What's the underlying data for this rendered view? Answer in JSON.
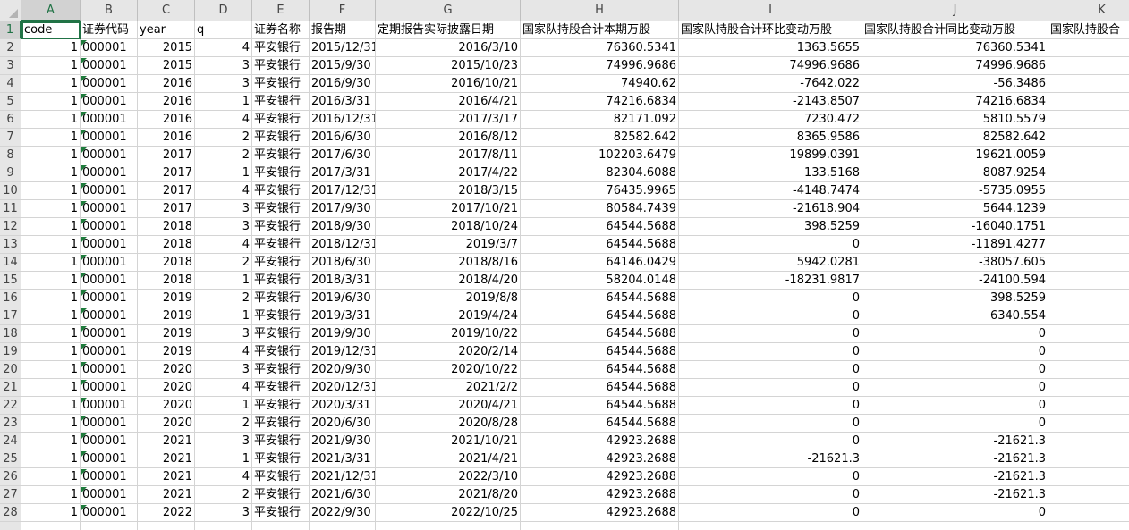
{
  "columns": [
    "A",
    "B",
    "C",
    "D",
    "E",
    "F",
    "G",
    "H",
    "I",
    "J",
    "K"
  ],
  "active_cell": "A1",
  "header_row": [
    "code",
    "证券代码",
    "year",
    "q",
    "证券名称",
    "报告期",
    "定期报告实际披露日期",
    "国家队持股合计本期万股",
    "国家队持股合计环比变动万股",
    "国家队持股合计同比变动万股",
    "国家队持股合"
  ],
  "rows": [
    {
      "n": "2",
      "code": "1",
      "sec": "000001",
      "year": "2015",
      "q": "4",
      "name": "平安银行",
      "period": "2015/12/31",
      "date": "2016/3/10",
      "h": "76360.5341",
      "i": "1363.5655",
      "j": "76360.5341"
    },
    {
      "n": "3",
      "code": "1",
      "sec": "000001",
      "year": "2015",
      "q": "3",
      "name": "平安银行",
      "period": "2015/9/30",
      "date": "2015/10/23",
      "h": "74996.9686",
      "i": "74996.9686",
      "j": "74996.9686"
    },
    {
      "n": "4",
      "code": "1",
      "sec": "000001",
      "year": "2016",
      "q": "3",
      "name": "平安银行",
      "period": "2016/9/30",
      "date": "2016/10/21",
      "h": "74940.62",
      "i": "-7642.022",
      "j": "-56.3486"
    },
    {
      "n": "5",
      "code": "1",
      "sec": "000001",
      "year": "2016",
      "q": "1",
      "name": "平安银行",
      "period": "2016/3/31",
      "date": "2016/4/21",
      "h": "74216.6834",
      "i": "-2143.8507",
      "j": "74216.6834"
    },
    {
      "n": "6",
      "code": "1",
      "sec": "000001",
      "year": "2016",
      "q": "4",
      "name": "平安银行",
      "period": "2016/12/31",
      "date": "2017/3/17",
      "h": "82171.092",
      "i": "7230.472",
      "j": "5810.5579"
    },
    {
      "n": "7",
      "code": "1",
      "sec": "000001",
      "year": "2016",
      "q": "2",
      "name": "平安银行",
      "period": "2016/6/30",
      "date": "2016/8/12",
      "h": "82582.642",
      "i": "8365.9586",
      "j": "82582.642"
    },
    {
      "n": "8",
      "code": "1",
      "sec": "000001",
      "year": "2017",
      "q": "2",
      "name": "平安银行",
      "period": "2017/6/30",
      "date": "2017/8/11",
      "h": "102203.6479",
      "i": "19899.0391",
      "j": "19621.0059"
    },
    {
      "n": "9",
      "code": "1",
      "sec": "000001",
      "year": "2017",
      "q": "1",
      "name": "平安银行",
      "period": "2017/3/31",
      "date": "2017/4/22",
      "h": "82304.6088",
      "i": "133.5168",
      "j": "8087.9254"
    },
    {
      "n": "10",
      "code": "1",
      "sec": "000001",
      "year": "2017",
      "q": "4",
      "name": "平安银行",
      "period": "2017/12/31",
      "date": "2018/3/15",
      "h": "76435.9965",
      "i": "-4148.7474",
      "j": "-5735.0955"
    },
    {
      "n": "11",
      "code": "1",
      "sec": "000001",
      "year": "2017",
      "q": "3",
      "name": "平安银行",
      "period": "2017/9/30",
      "date": "2017/10/21",
      "h": "80584.7439",
      "i": "-21618.904",
      "j": "5644.1239"
    },
    {
      "n": "12",
      "code": "1",
      "sec": "000001",
      "year": "2018",
      "q": "3",
      "name": "平安银行",
      "period": "2018/9/30",
      "date": "2018/10/24",
      "h": "64544.5688",
      "i": "398.5259",
      "j": "-16040.1751"
    },
    {
      "n": "13",
      "code": "1",
      "sec": "000001",
      "year": "2018",
      "q": "4",
      "name": "平安银行",
      "period": "2018/12/31",
      "date": "2019/3/7",
      "h": "64544.5688",
      "i": "0",
      "j": "-11891.4277"
    },
    {
      "n": "14",
      "code": "1",
      "sec": "000001",
      "year": "2018",
      "q": "2",
      "name": "平安银行",
      "period": "2018/6/30",
      "date": "2018/8/16",
      "h": "64146.0429",
      "i": "5942.0281",
      "j": "-38057.605"
    },
    {
      "n": "15",
      "code": "1",
      "sec": "000001",
      "year": "2018",
      "q": "1",
      "name": "平安银行",
      "period": "2018/3/31",
      "date": "2018/4/20",
      "h": "58204.0148",
      "i": "-18231.9817",
      "j": "-24100.594"
    },
    {
      "n": "16",
      "code": "1",
      "sec": "000001",
      "year": "2019",
      "q": "2",
      "name": "平安银行",
      "period": "2019/6/30",
      "date": "2019/8/8",
      "h": "64544.5688",
      "i": "0",
      "j": "398.5259"
    },
    {
      "n": "17",
      "code": "1",
      "sec": "000001",
      "year": "2019",
      "q": "1",
      "name": "平安银行",
      "period": "2019/3/31",
      "date": "2019/4/24",
      "h": "64544.5688",
      "i": "0",
      "j": "6340.554"
    },
    {
      "n": "18",
      "code": "1",
      "sec": "000001",
      "year": "2019",
      "q": "3",
      "name": "平安银行",
      "period": "2019/9/30",
      "date": "2019/10/22",
      "h": "64544.5688",
      "i": "0",
      "j": "0"
    },
    {
      "n": "19",
      "code": "1",
      "sec": "000001",
      "year": "2019",
      "q": "4",
      "name": "平安银行",
      "period": "2019/12/31",
      "date": "2020/2/14",
      "h": "64544.5688",
      "i": "0",
      "j": "0"
    },
    {
      "n": "20",
      "code": "1",
      "sec": "000001",
      "year": "2020",
      "q": "3",
      "name": "平安银行",
      "period": "2020/9/30",
      "date": "2020/10/22",
      "h": "64544.5688",
      "i": "0",
      "j": "0"
    },
    {
      "n": "21",
      "code": "1",
      "sec": "000001",
      "year": "2020",
      "q": "4",
      "name": "平安银行",
      "period": "2020/12/31",
      "date": "2021/2/2",
      "h": "64544.5688",
      "i": "0",
      "j": "0"
    },
    {
      "n": "22",
      "code": "1",
      "sec": "000001",
      "year": "2020",
      "q": "1",
      "name": "平安银行",
      "period": "2020/3/31",
      "date": "2020/4/21",
      "h": "64544.5688",
      "i": "0",
      "j": "0"
    },
    {
      "n": "23",
      "code": "1",
      "sec": "000001",
      "year": "2020",
      "q": "2",
      "name": "平安银行",
      "period": "2020/6/30",
      "date": "2020/8/28",
      "h": "64544.5688",
      "i": "0",
      "j": "0"
    },
    {
      "n": "24",
      "code": "1",
      "sec": "000001",
      "year": "2021",
      "q": "3",
      "name": "平安银行",
      "period": "2021/9/30",
      "date": "2021/10/21",
      "h": "42923.2688",
      "i": "0",
      "j": "-21621.3"
    },
    {
      "n": "25",
      "code": "1",
      "sec": "000001",
      "year": "2021",
      "q": "1",
      "name": "平安银行",
      "period": "2021/3/31",
      "date": "2021/4/21",
      "h": "42923.2688",
      "i": "-21621.3",
      "j": "-21621.3"
    },
    {
      "n": "26",
      "code": "1",
      "sec": "000001",
      "year": "2021",
      "q": "4",
      "name": "平安银行",
      "period": "2021/12/31",
      "date": "2022/3/10",
      "h": "42923.2688",
      "i": "0",
      "j": "-21621.3"
    },
    {
      "n": "27",
      "code": "1",
      "sec": "000001",
      "year": "2021",
      "q": "2",
      "name": "平安银行",
      "period": "2021/6/30",
      "date": "2021/8/20",
      "h": "42923.2688",
      "i": "0",
      "j": "-21621.3"
    },
    {
      "n": "28",
      "code": "1",
      "sec": "000001",
      "year": "2022",
      "q": "3",
      "name": "平安银行",
      "period": "2022/9/30",
      "date": "2022/10/25",
      "h": "42923.2688",
      "i": "0",
      "j": "0"
    }
  ],
  "colors": {
    "accent": "#217346",
    "grid": "#d4d4d4",
    "header_bg": "#e6e6e6",
    "error_tag": "#1e7c3c"
  }
}
